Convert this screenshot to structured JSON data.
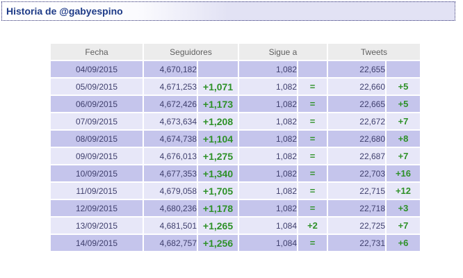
{
  "title": "Historia de @gabyespino",
  "colors": {
    "accent_green": "#2e9128",
    "row_dark": "#c5c5ec",
    "row_light": "#e7e7f8",
    "header_bg": "#ececec",
    "title_bg": "#e2e2f4",
    "title_text": "#1d3a87",
    "border_navy": "#2a2a70",
    "value_text": "#3f3f6d"
  },
  "table": {
    "headers": [
      "Fecha",
      "Seguidores",
      "Sigue a",
      "Tweets"
    ],
    "rows": [
      {
        "fecha": "04/09/2015",
        "seguidores": "4,670,182",
        "seguidores_delta": "",
        "sigue_a": "1,082",
        "sigue_a_delta": "",
        "tweets": "22,655",
        "tweets_delta": ""
      },
      {
        "fecha": "05/09/2015",
        "seguidores": "4,671,253",
        "seguidores_delta": "+1,071",
        "sigue_a": "1,082",
        "sigue_a_delta": "=",
        "tweets": "22,660",
        "tweets_delta": "+5"
      },
      {
        "fecha": "06/09/2015",
        "seguidores": "4,672,426",
        "seguidores_delta": "+1,173",
        "sigue_a": "1,082",
        "sigue_a_delta": "=",
        "tweets": "22,665",
        "tweets_delta": "+5"
      },
      {
        "fecha": "07/09/2015",
        "seguidores": "4,673,634",
        "seguidores_delta": "+1,208",
        "sigue_a": "1,082",
        "sigue_a_delta": "=",
        "tweets": "22,672",
        "tweets_delta": "+7"
      },
      {
        "fecha": "08/09/2015",
        "seguidores": "4,674,738",
        "seguidores_delta": "+1,104",
        "sigue_a": "1,082",
        "sigue_a_delta": "=",
        "tweets": "22,680",
        "tweets_delta": "+8"
      },
      {
        "fecha": "09/09/2015",
        "seguidores": "4,676,013",
        "seguidores_delta": "+1,275",
        "sigue_a": "1,082",
        "sigue_a_delta": "=",
        "tweets": "22,687",
        "tweets_delta": "+7"
      },
      {
        "fecha": "10/09/2015",
        "seguidores": "4,677,353",
        "seguidores_delta": "+1,340",
        "sigue_a": "1,082",
        "sigue_a_delta": "=",
        "tweets": "22,703",
        "tweets_delta": "+16"
      },
      {
        "fecha": "11/09/2015",
        "seguidores": "4,679,058",
        "seguidores_delta": "+1,705",
        "sigue_a": "1,082",
        "sigue_a_delta": "=",
        "tweets": "22,715",
        "tweets_delta": "+12"
      },
      {
        "fecha": "12/09/2015",
        "seguidores": "4,680,236",
        "seguidores_delta": "+1,178",
        "sigue_a": "1,082",
        "sigue_a_delta": "=",
        "tweets": "22,718",
        "tweets_delta": "+3"
      },
      {
        "fecha": "13/09/2015",
        "seguidores": "4,681,501",
        "seguidores_delta": "+1,265",
        "sigue_a": "1,084",
        "sigue_a_delta": "+2",
        "tweets": "22,725",
        "tweets_delta": "+7"
      },
      {
        "fecha": "14/09/2015",
        "seguidores": "4,682,757",
        "seguidores_delta": "+1,256",
        "sigue_a": "1,084",
        "sigue_a_delta": "=",
        "tweets": "22,731",
        "tweets_delta": "+6"
      }
    ]
  }
}
